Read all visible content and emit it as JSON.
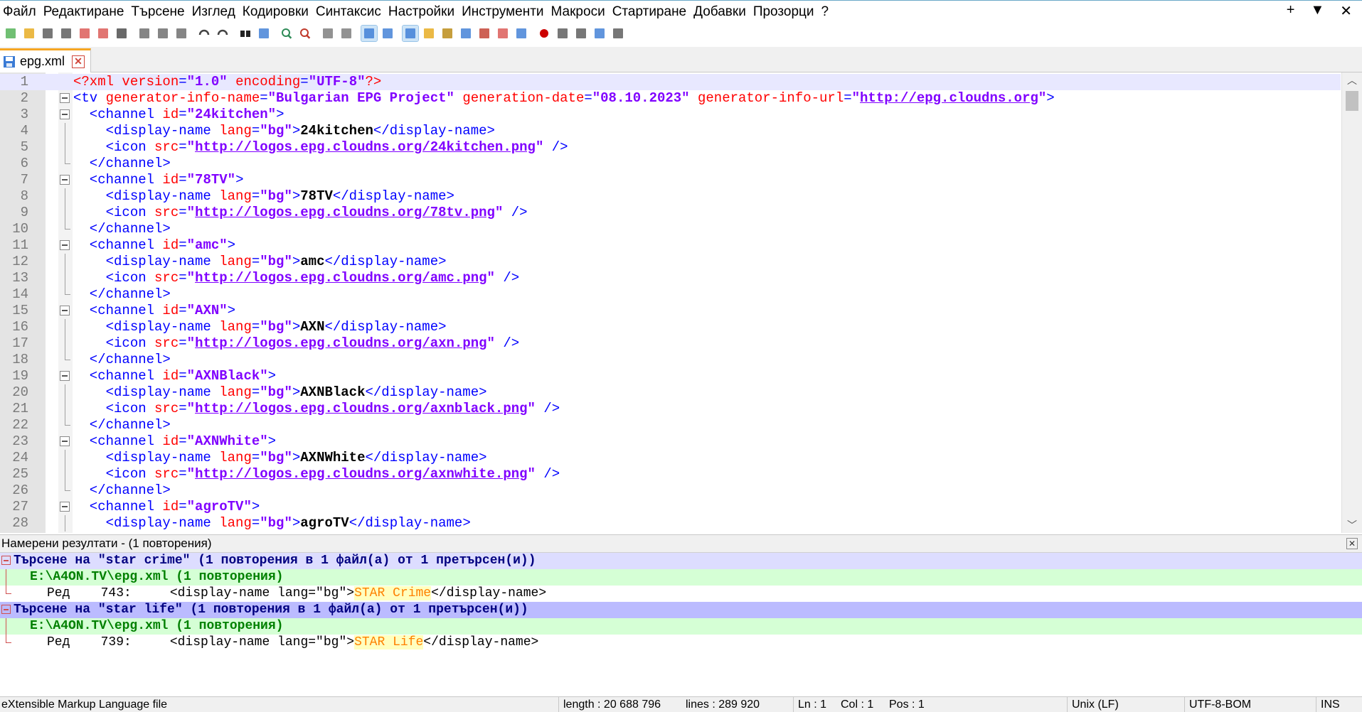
{
  "menu": {
    "items": [
      "Файл",
      "Редактиране",
      "Търсене",
      "Изглед",
      "Кодировки",
      "Синтаксис",
      "Настройки",
      "Инструменти",
      "Макроси",
      "Стартиране",
      "Добавки",
      "Прозорци",
      "?"
    ],
    "right": [
      "+",
      "▼",
      "✕"
    ]
  },
  "tab": {
    "label": "epg.xml"
  },
  "editor": {
    "lines": [
      {
        "n": "1",
        "parts": [
          [
            "pi",
            "<?xml "
          ],
          [
            "attr",
            "version"
          ],
          [
            "tag",
            "="
          ],
          [
            "val",
            "\"1.0\""
          ],
          [
            "tag",
            " "
          ],
          [
            "attr",
            "encoding"
          ],
          [
            "tag",
            "="
          ],
          [
            "val",
            "\"UTF-8\""
          ],
          [
            "pi",
            "?>"
          ]
        ],
        "fold": "none"
      },
      {
        "n": "2",
        "parts": [
          [
            "tag",
            "<tv "
          ],
          [
            "attr",
            "generator-info-name"
          ],
          [
            "tag",
            "="
          ],
          [
            "val",
            "\"Bulgarian EPG Project\""
          ],
          [
            "tag",
            " "
          ],
          [
            "attr",
            "generation-date"
          ],
          [
            "tag",
            "="
          ],
          [
            "val",
            "\"08.10.2023\""
          ],
          [
            "tag",
            " "
          ],
          [
            "attr",
            "generator-info-url"
          ],
          [
            "tag",
            "="
          ],
          [
            "val",
            "\""
          ],
          [
            "url",
            "http://epg.cloudns.org"
          ],
          [
            "val",
            "\""
          ],
          [
            "tag",
            ">"
          ]
        ],
        "fold": "open"
      },
      {
        "n": "3",
        "parts": [
          [
            "tag",
            "  <channel "
          ],
          [
            "attr",
            "id"
          ],
          [
            "tag",
            "="
          ],
          [
            "val",
            "\"24kitchen\""
          ],
          [
            "tag",
            ">"
          ]
        ],
        "fold": "open"
      },
      {
        "n": "4",
        "parts": [
          [
            "tag",
            "    <display-name "
          ],
          [
            "attr",
            "lang"
          ],
          [
            "tag",
            "="
          ],
          [
            "val",
            "\"bg\""
          ],
          [
            "tag",
            ">"
          ],
          [
            "bold",
            "24kitchen"
          ],
          [
            "tag",
            "</display-name>"
          ]
        ],
        "fold": "line"
      },
      {
        "n": "5",
        "parts": [
          [
            "tag",
            "    <icon "
          ],
          [
            "attr",
            "src"
          ],
          [
            "tag",
            "="
          ],
          [
            "val",
            "\""
          ],
          [
            "url",
            "http://logos.epg.cloudns.org/24kitchen.png"
          ],
          [
            "val",
            "\""
          ],
          [
            "tag",
            " />"
          ]
        ],
        "fold": "line"
      },
      {
        "n": "6",
        "parts": [
          [
            "tag",
            "  </channel>"
          ]
        ],
        "fold": "end"
      },
      {
        "n": "7",
        "parts": [
          [
            "tag",
            "  <channel "
          ],
          [
            "attr",
            "id"
          ],
          [
            "tag",
            "="
          ],
          [
            "val",
            "\"78TV\""
          ],
          [
            "tag",
            ">"
          ]
        ],
        "fold": "open"
      },
      {
        "n": "8",
        "parts": [
          [
            "tag",
            "    <display-name "
          ],
          [
            "attr",
            "lang"
          ],
          [
            "tag",
            "="
          ],
          [
            "val",
            "\"bg\""
          ],
          [
            "tag",
            ">"
          ],
          [
            "bold",
            "78TV"
          ],
          [
            "tag",
            "</display-name>"
          ]
        ],
        "fold": "line"
      },
      {
        "n": "9",
        "parts": [
          [
            "tag",
            "    <icon "
          ],
          [
            "attr",
            "src"
          ],
          [
            "tag",
            "="
          ],
          [
            "val",
            "\""
          ],
          [
            "url",
            "http://logos.epg.cloudns.org/78tv.png"
          ],
          [
            "val",
            "\""
          ],
          [
            "tag",
            " />"
          ]
        ],
        "fold": "line"
      },
      {
        "n": "10",
        "parts": [
          [
            "tag",
            "  </channel>"
          ]
        ],
        "fold": "end"
      },
      {
        "n": "11",
        "parts": [
          [
            "tag",
            "  <channel "
          ],
          [
            "attr",
            "id"
          ],
          [
            "tag",
            "="
          ],
          [
            "val",
            "\"amc\""
          ],
          [
            "tag",
            ">"
          ]
        ],
        "fold": "open"
      },
      {
        "n": "12",
        "parts": [
          [
            "tag",
            "    <display-name "
          ],
          [
            "attr",
            "lang"
          ],
          [
            "tag",
            "="
          ],
          [
            "val",
            "\"bg\""
          ],
          [
            "tag",
            ">"
          ],
          [
            "bold",
            "amc"
          ],
          [
            "tag",
            "</display-name>"
          ]
        ],
        "fold": "line"
      },
      {
        "n": "13",
        "parts": [
          [
            "tag",
            "    <icon "
          ],
          [
            "attr",
            "src"
          ],
          [
            "tag",
            "="
          ],
          [
            "val",
            "\""
          ],
          [
            "url",
            "http://logos.epg.cloudns.org/amc.png"
          ],
          [
            "val",
            "\""
          ],
          [
            "tag",
            " />"
          ]
        ],
        "fold": "line"
      },
      {
        "n": "14",
        "parts": [
          [
            "tag",
            "  </channel>"
          ]
        ],
        "fold": "end"
      },
      {
        "n": "15",
        "parts": [
          [
            "tag",
            "  <channel "
          ],
          [
            "attr",
            "id"
          ],
          [
            "tag",
            "="
          ],
          [
            "val",
            "\"AXN\""
          ],
          [
            "tag",
            ">"
          ]
        ],
        "fold": "open"
      },
      {
        "n": "16",
        "parts": [
          [
            "tag",
            "    <display-name "
          ],
          [
            "attr",
            "lang"
          ],
          [
            "tag",
            "="
          ],
          [
            "val",
            "\"bg\""
          ],
          [
            "tag",
            ">"
          ],
          [
            "bold",
            "AXN"
          ],
          [
            "tag",
            "</display-name>"
          ]
        ],
        "fold": "line"
      },
      {
        "n": "17",
        "parts": [
          [
            "tag",
            "    <icon "
          ],
          [
            "attr",
            "src"
          ],
          [
            "tag",
            "="
          ],
          [
            "val",
            "\""
          ],
          [
            "url",
            "http://logos.epg.cloudns.org/axn.png"
          ],
          [
            "val",
            "\""
          ],
          [
            "tag",
            " />"
          ]
        ],
        "fold": "line"
      },
      {
        "n": "18",
        "parts": [
          [
            "tag",
            "  </channel>"
          ]
        ],
        "fold": "end"
      },
      {
        "n": "19",
        "parts": [
          [
            "tag",
            "  <channel "
          ],
          [
            "attr",
            "id"
          ],
          [
            "tag",
            "="
          ],
          [
            "val",
            "\"AXNBlack\""
          ],
          [
            "tag",
            ">"
          ]
        ],
        "fold": "open"
      },
      {
        "n": "20",
        "parts": [
          [
            "tag",
            "    <display-name "
          ],
          [
            "attr",
            "lang"
          ],
          [
            "tag",
            "="
          ],
          [
            "val",
            "\"bg\""
          ],
          [
            "tag",
            ">"
          ],
          [
            "bold",
            "AXNBlack"
          ],
          [
            "tag",
            "</display-name>"
          ]
        ],
        "fold": "line"
      },
      {
        "n": "21",
        "parts": [
          [
            "tag",
            "    <icon "
          ],
          [
            "attr",
            "src"
          ],
          [
            "tag",
            "="
          ],
          [
            "val",
            "\""
          ],
          [
            "url",
            "http://logos.epg.cloudns.org/axnblack.png"
          ],
          [
            "val",
            "\""
          ],
          [
            "tag",
            " />"
          ]
        ],
        "fold": "line"
      },
      {
        "n": "22",
        "parts": [
          [
            "tag",
            "  </channel>"
          ]
        ],
        "fold": "end"
      },
      {
        "n": "23",
        "parts": [
          [
            "tag",
            "  <channel "
          ],
          [
            "attr",
            "id"
          ],
          [
            "tag",
            "="
          ],
          [
            "val",
            "\"AXNWhite\""
          ],
          [
            "tag",
            ">"
          ]
        ],
        "fold": "open"
      },
      {
        "n": "24",
        "parts": [
          [
            "tag",
            "    <display-name "
          ],
          [
            "attr",
            "lang"
          ],
          [
            "tag",
            "="
          ],
          [
            "val",
            "\"bg\""
          ],
          [
            "tag",
            ">"
          ],
          [
            "bold",
            "AXNWhite"
          ],
          [
            "tag",
            "</display-name>"
          ]
        ],
        "fold": "line"
      },
      {
        "n": "25",
        "parts": [
          [
            "tag",
            "    <icon "
          ],
          [
            "attr",
            "src"
          ],
          [
            "tag",
            "="
          ],
          [
            "val",
            "\""
          ],
          [
            "url",
            "http://logos.epg.cloudns.org/axnwhite.png"
          ],
          [
            "val",
            "\""
          ],
          [
            "tag",
            " />"
          ]
        ],
        "fold": "line"
      },
      {
        "n": "26",
        "parts": [
          [
            "tag",
            "  </channel>"
          ]
        ],
        "fold": "end"
      },
      {
        "n": "27",
        "parts": [
          [
            "tag",
            "  <channel "
          ],
          [
            "attr",
            "id"
          ],
          [
            "tag",
            "="
          ],
          [
            "val",
            "\"agroTV\""
          ],
          [
            "tag",
            ">"
          ]
        ],
        "fold": "open"
      },
      {
        "n": "28",
        "parts": [
          [
            "tag",
            "    <display-name "
          ],
          [
            "attr",
            "lang"
          ],
          [
            "tag",
            "="
          ],
          [
            "val",
            "\"bg\""
          ],
          [
            "tag",
            ">"
          ],
          [
            "bold",
            "agroTV"
          ],
          [
            "tag",
            "</display-name>"
          ]
        ],
        "fold": "line"
      }
    ]
  },
  "results": {
    "title": "Намерени резултати - (1 повторения)",
    "close": "✕",
    "lines": [
      {
        "kind": "search",
        "text": "Търсене на \"star crime\" (1 повторения в 1 файл(а) от 1 претърсен(и))",
        "fold": "open"
      },
      {
        "kind": "file",
        "text": "E:\\A4ON.TV\\epg.xml (1 повторения)",
        "fold": "line"
      },
      {
        "kind": "hit",
        "pre": "Ред    743:     <display-name lang=\"bg\">",
        "hl": "STAR Crime",
        "post": "</display-name>",
        "fold": "end"
      },
      {
        "kind": "search sel",
        "text": "Търсене на \"star life\" (1 повторения в 1 файл(а) от 1 претърсен(и))",
        "fold": "open"
      },
      {
        "kind": "file",
        "text": "E:\\A4ON.TV\\epg.xml (1 повторения)",
        "fold": "line"
      },
      {
        "kind": "hit",
        "pre": "Ред    739:     <display-name lang=\"bg\">",
        "hl": "STAR Life",
        "post": "</display-name>",
        "fold": "end"
      }
    ]
  },
  "status": {
    "filetype": "eXtensible Markup Language file",
    "length": "length : 20 688 796",
    "lines": "lines : 289 920",
    "ln": "Ln : 1",
    "col": "Col : 1",
    "pos": "Pos : 1",
    "eol": "Unix (LF)",
    "encoding": "UTF-8-BOM",
    "mode": "INS"
  },
  "toolbar": {
    "icons": [
      "new-file-icon",
      "open-file-icon",
      "save-icon",
      "save-all-icon",
      "close-icon",
      "close-all-icon",
      "print-icon",
      "sep",
      "cut-icon",
      "copy-icon",
      "paste-icon",
      "sep",
      "undo-icon",
      "redo-icon",
      "sep",
      "find-icon",
      "replace-icon",
      "sep",
      "zoom-in-icon",
      "zoom-out-icon",
      "sep",
      "sync-vertical-icon",
      "sync-horizontal-icon",
      "sep",
      "word-wrap-icon",
      "show-all-chars-icon",
      "sep",
      "indent-guide-icon",
      "user-language-icon",
      "doc-map-icon",
      "doc-list-icon",
      "function-list-icon",
      "folder-workspace-icon",
      "monitoring-icon",
      "sep",
      "record-macro-icon",
      "stop-macro-icon",
      "play-macro-icon",
      "run-macro-multiple-icon",
      "save-macro-icon"
    ],
    "active": [
      "word-wrap-icon",
      "indent-guide-icon"
    ]
  }
}
